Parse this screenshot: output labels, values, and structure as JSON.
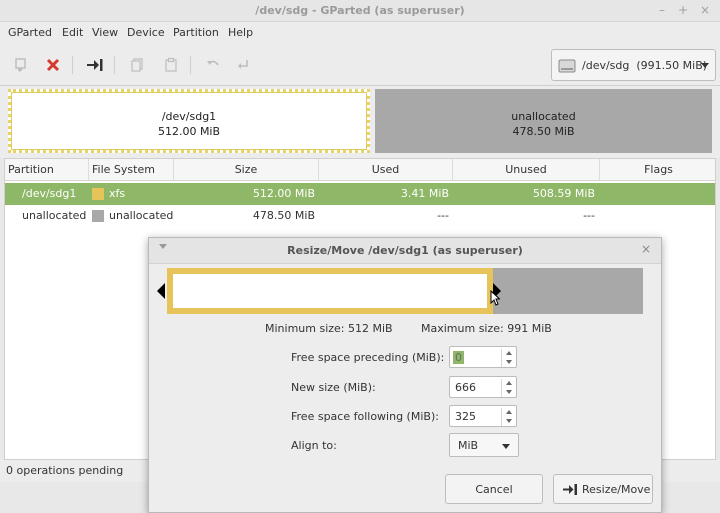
{
  "window": {
    "title": "/dev/sdg - GParted (as superuser)"
  },
  "menu": [
    "GParted",
    "Edit",
    "View",
    "Device",
    "Partition",
    "Help"
  ],
  "toolbar": {
    "device_path": "/dev/sdg",
    "device_size": "(991.50 MiB)",
    "icons": [
      "new-partition-icon",
      "delete-icon",
      "resize-move-icon",
      "copy-icon",
      "paste-icon",
      "undo-icon",
      "apply-icon"
    ]
  },
  "graph": {
    "partition": {
      "name": "/dev/sdg1",
      "size": "512.00 MiB"
    },
    "unallocated": {
      "name": "unallocated",
      "size": "478.50 MiB"
    }
  },
  "table": {
    "columns": [
      "Partition",
      "File System",
      "Size",
      "Used",
      "Unused",
      "Flags"
    ],
    "rows": [
      {
        "partition": "/dev/sdg1",
        "fs": "xfs",
        "size": "512.00 MiB",
        "used": "3.41 MiB",
        "unused": "508.59 MiB",
        "flags": "",
        "fs_color": "#e6c45a"
      },
      {
        "partition": "unallocated",
        "fs": "unallocated",
        "size": "478.50 MiB",
        "used": "---",
        "unused": "---",
        "flags": "",
        "fs_color": "#a8a8a8"
      }
    ]
  },
  "status": {
    "text": "0 operations pending"
  },
  "dialog": {
    "title": "Resize/Move /dev/sdg1 (as superuser)",
    "min_size": "Minimum size: 512 MiB",
    "max_size": "Maximum size: 991 MiB",
    "fields": {
      "preceding_label": "Free space preceding (MiB):",
      "preceding_value": "0",
      "new_size_label": "New size (MiB):",
      "new_size_value": "666",
      "following_label": "Free space following (MiB):",
      "following_value": "325",
      "align_label": "Align to:",
      "align_value": "MiB"
    },
    "buttons": {
      "cancel": "Cancel",
      "resize": "Resize/Move"
    }
  },
  "colors": {
    "selection": "#8fb768",
    "xfs": "#e6c45a",
    "unallocated": "#a8a8a8",
    "delete": "#d43a2e"
  }
}
